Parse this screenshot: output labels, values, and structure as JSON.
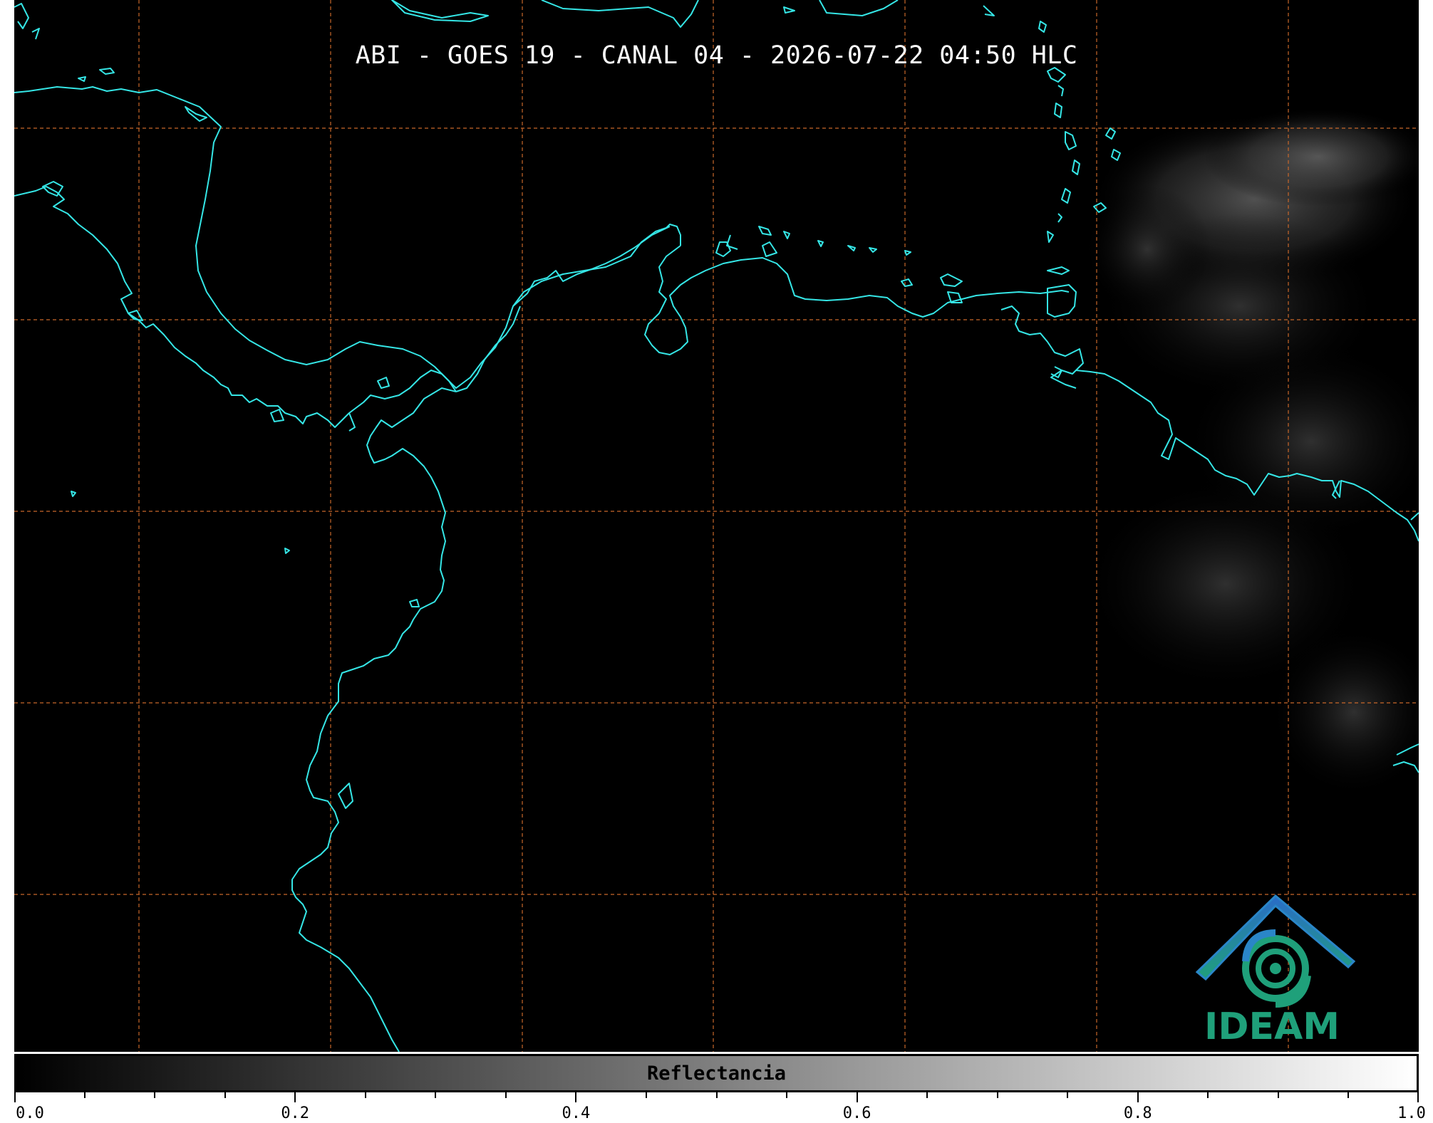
{
  "title": "ABI - GOES 19 - CANAL 04 - 2026-07-22 04:50 HLC",
  "colors": {
    "background": "#000000",
    "coastline": "#35e6e6",
    "gridline": "#c8672a",
    "logo_blue": "#2a86c8",
    "logo_green": "#1fa07a"
  },
  "logo": {
    "name": "IDEAM-logo",
    "text": "IDEAM"
  },
  "colorbar": {
    "label": "Reflectancia",
    "gradient": [
      "#000000",
      "#ffffff"
    ],
    "ticks": [
      {
        "value": 0.0,
        "label": "0.0"
      },
      {
        "value": 0.2,
        "label": "0.2"
      },
      {
        "value": 0.4,
        "label": "0.4"
      },
      {
        "value": 0.6,
        "label": "0.6"
      },
      {
        "value": 0.8,
        "label": "0.8"
      },
      {
        "value": 1.0,
        "label": "1.0"
      }
    ],
    "minor_step": 0.05
  },
  "map": {
    "grid": "dashed",
    "features": [
      "coastline",
      "cloud-field-east"
    ]
  }
}
